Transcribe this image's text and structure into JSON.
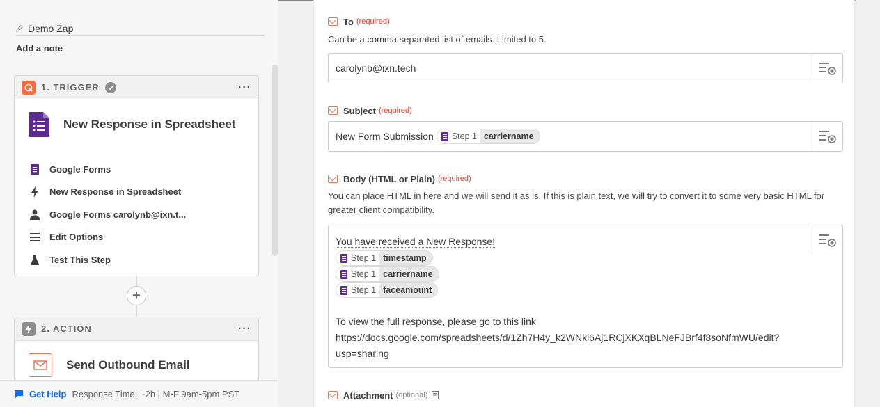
{
  "left": {
    "zap_name": "Demo Zap",
    "add_note": "Add a note",
    "trigger": {
      "header": "1. TRIGGER",
      "title": "New Response in Spreadsheet",
      "items": [
        {
          "icon": "google-forms-icon",
          "label": "Google Forms"
        },
        {
          "icon": "lightning-icon",
          "label": "New Response in Spreadsheet"
        },
        {
          "icon": "user-icon",
          "label": "Google Forms carolynb@ixn.t..."
        },
        {
          "icon": "lines-icon",
          "label": "Edit Options"
        },
        {
          "icon": "flask-icon",
          "label": "Test This Step"
        }
      ]
    },
    "action": {
      "header": "2. ACTION",
      "title": "Send Outbound Email"
    },
    "help": {
      "link": "Get Help",
      "text": "Response Time: ~2h | M-F 9am-5pm PST"
    }
  },
  "main": {
    "to": {
      "label": "To",
      "required": "(required)",
      "help": "Can be a comma separated list of emails. Limited to 5.",
      "value": "carolynb@ixn.tech"
    },
    "subject": {
      "label": "Subject",
      "required": "(required)",
      "prefix": "New Form Submission",
      "pill": {
        "step": "Step 1",
        "value": "carriername"
      }
    },
    "body": {
      "label": "Body (HTML or Plain)",
      "required": "(required)",
      "help": "You can place HTML in here and we will send it as is. If this is plain text, we will try to convert it to some very basic HTML for greater client compatibility.",
      "first_line": "You have received a New Response!",
      "pills": [
        {
          "step": "Step 1",
          "value": "timestamp"
        },
        {
          "step": "Step 1",
          "value": "carriername"
        },
        {
          "step": "Step 1",
          "value": "faceamount"
        }
      ],
      "link_intro": "To view the full response, please go to this link",
      "link_line1": "https://docs.google.com/spreadsheets/d/1Zh7H4y_k2WNkl6Aj1RCjXKXqBLNeFJBrf4f8soNfmWU/edit?",
      "link_line2": "usp=sharing"
    },
    "attachment": {
      "label": "Attachment",
      "optional": "(optional)"
    }
  },
  "colors": {
    "accent": "#136bf5",
    "required": "#e5402b",
    "google_forms": "#5d2b90",
    "trigger_orange": "#ff6a3d"
  }
}
